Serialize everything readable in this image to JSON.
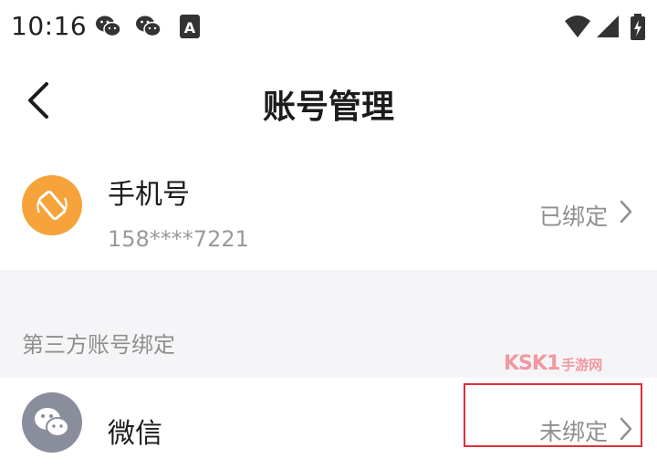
{
  "status_bar": {
    "time": "10:16",
    "icons": [
      "wechat-icon",
      "wechat-icon",
      "text-a-icon",
      "wifi-icon",
      "signal-icon",
      "battery-charging-icon"
    ]
  },
  "nav": {
    "title": "账号管理",
    "back_icon": "back-arrow-icon"
  },
  "phone": {
    "label": "手机号",
    "number": "158****7221",
    "status": "已绑定",
    "icon": "phone-rotate-icon",
    "accent": "#f5a33a"
  },
  "third_party": {
    "section_title": "第三方账号绑定",
    "items": [
      {
        "label": "微信",
        "status": "未绑定",
        "icon": "wechat-icon",
        "accent": "#8a8d9c"
      }
    ]
  },
  "watermark_text": "KSK1手游网",
  "colors": {
    "highlight": "#e0303a",
    "section_bg": "#f5f5f7"
  }
}
